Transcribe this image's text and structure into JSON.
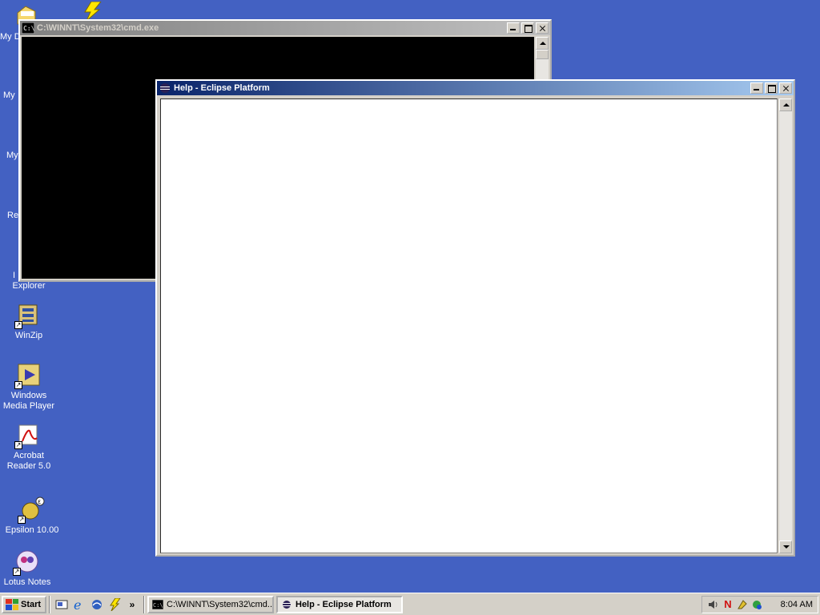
{
  "desktop": {
    "icons": [
      {
        "label": "My D"
      },
      {
        "label": "My"
      },
      {
        "label": "My"
      },
      {
        "label": "Re"
      },
      {
        "label": "I"
      },
      {
        "label": "Explorer"
      },
      {
        "label": "WinZip"
      },
      {
        "label": "Windows Media Player"
      },
      {
        "label": "Acrobat Reader 5.0"
      },
      {
        "label": "Epsilon 10.00"
      },
      {
        "label": "Lotus Notes"
      }
    ]
  },
  "cmd_window": {
    "title": "C:\\WINNT\\System32\\cmd.exe",
    "icon": "cmd-icon"
  },
  "help_window": {
    "title": "Help - Eclipse Platform",
    "icon": "eclipse-icon"
  },
  "taskbar": {
    "start_label": "Start",
    "quick_launch": [
      "show-desktop-icon",
      "internet-explorer-icon",
      "outlook-express-icon",
      "winamp-icon"
    ],
    "overflow": "»",
    "tasks": [
      {
        "label": "C:\\WINNT\\System32\\cmd...",
        "active": false
      },
      {
        "label": "Help - Eclipse Platform",
        "active": true
      }
    ],
    "tray": {
      "icons": [
        "volume-icon",
        "norton-icon",
        "tray-app-icon",
        "network-icon"
      ],
      "n_glyph": "N",
      "clock": "8:04 AM"
    }
  },
  "colors": {
    "desktop": "#4361c2",
    "active_title_start": "#0a246a",
    "active_title_end": "#a6caf0",
    "inactive_title_start": "#808080",
    "inactive_title_end": "#c0c0c0",
    "face": "#d4d0c8"
  }
}
